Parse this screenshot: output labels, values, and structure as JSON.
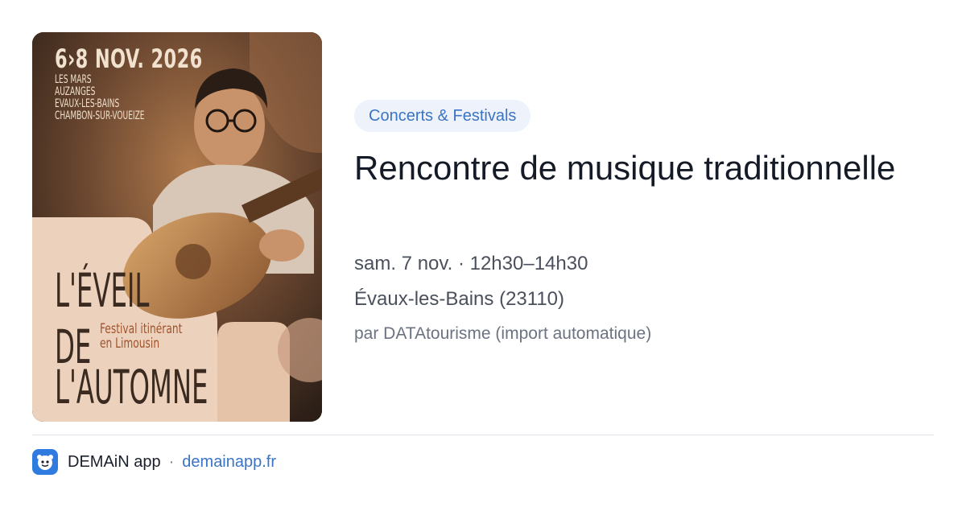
{
  "poster": {
    "date_line": "6›8 NOV. 2026",
    "places": [
      "LES MARS",
      "AUZANGES",
      "EVAUX-LES-BAINS",
      "CHAMBON-SUR-VOUEIZE"
    ],
    "title_lines": [
      "L'ÉVEIL",
      "DE",
      "L'AUTOMNE"
    ],
    "subtitle_lines": [
      "Festival itinérant",
      "en Limousin"
    ]
  },
  "event": {
    "category": "Concerts & Festivals",
    "title": "Rencontre de musique traditionnelle",
    "when": "sam. 7 nov. · 12h30–14h30",
    "where": "Évaux-les-Bains (23110)",
    "source": "par DATAtourisme (import automatique)"
  },
  "footer": {
    "app_name": "DEMAiN app",
    "separator": "·",
    "url": "demainapp.fr"
  },
  "colors": {
    "accent": "#3a74c4",
    "badge_bg": "#eef3fb",
    "title": "#141a26",
    "meta": "#4a505c",
    "app_icon": "#2f7be0"
  }
}
